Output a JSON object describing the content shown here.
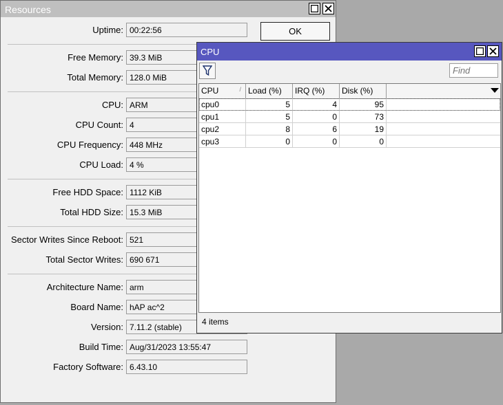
{
  "resources": {
    "title": "Resources",
    "ok_label": "OK",
    "rows": [
      {
        "label": "Uptime:",
        "value": "00:22:56"
      },
      {
        "label": "Free Memory:",
        "value": "39.3 MiB"
      },
      {
        "label": "Total Memory:",
        "value": "128.0 MiB"
      },
      {
        "label": "CPU:",
        "value": "ARM"
      },
      {
        "label": "CPU Count:",
        "value": "4"
      },
      {
        "label": "CPU Frequency:",
        "value": "448 MHz"
      },
      {
        "label": "CPU Load:",
        "value": "4 %"
      },
      {
        "label": "Free HDD Space:",
        "value": "1112 KiB"
      },
      {
        "label": "Total HDD Size:",
        "value": "15.3 MiB"
      },
      {
        "label": "Sector Writes Since Reboot:",
        "value": "521"
      },
      {
        "label": "Total Sector Writes:",
        "value": "690 671"
      },
      {
        "label": "Architecture Name:",
        "value": "arm"
      },
      {
        "label": "Board Name:",
        "value": "hAP ac^2"
      },
      {
        "label": "Version:",
        "value": "7.11.2 (stable)"
      },
      {
        "label": "Build Time:",
        "value": "Aug/31/2023 13:55:47"
      },
      {
        "label": "Factory Software:",
        "value": "6.43.10"
      }
    ]
  },
  "cpu_window": {
    "title": "CPU",
    "find_placeholder": "Find",
    "columns": [
      "CPU",
      "Load (%)",
      "IRQ (%)",
      "Disk (%)"
    ],
    "rows": [
      {
        "cpu": "cpu0",
        "load": "5",
        "irq": "4",
        "disk": "95"
      },
      {
        "cpu": "cpu1",
        "load": "5",
        "irq": "0",
        "disk": "73"
      },
      {
        "cpu": "cpu2",
        "load": "8",
        "irq": "6",
        "disk": "19"
      },
      {
        "cpu": "cpu3",
        "load": "0",
        "irq": "0",
        "disk": "0"
      }
    ],
    "status": "4 items"
  }
}
